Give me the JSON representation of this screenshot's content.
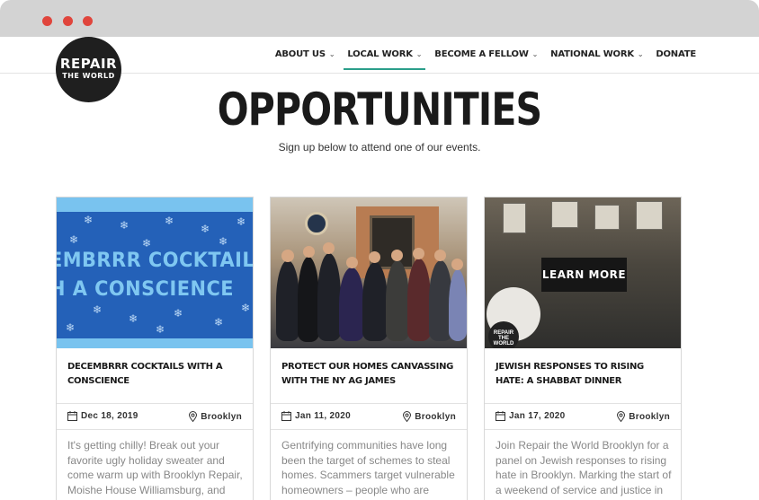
{
  "logo": {
    "line1": "REPAIR",
    "line2": "THE WORLD"
  },
  "nav": {
    "items": [
      {
        "label": "ABOUT US",
        "has_dropdown": true
      },
      {
        "label": "LOCAL WORK",
        "has_dropdown": true,
        "active": true
      },
      {
        "label": "BECOME A FELLOW",
        "has_dropdown": true
      },
      {
        "label": "NATIONAL WORK",
        "has_dropdown": true
      },
      {
        "label": "DONATE",
        "has_dropdown": false
      }
    ],
    "accent_color": "#2b9e8a"
  },
  "page": {
    "title": "OPPORTUNITIES",
    "subtitle": "Sign up below to attend one of our events."
  },
  "cards": [
    {
      "image": "snowflake-banner",
      "image_text_line1": "EMBRRR COCKTAILS",
      "image_text_line2": "H A CONSCIENCE",
      "title": "DECEMBRRR COCKTAILS WITH A CONSCIENCE",
      "date": "Dec 18, 2019",
      "location": "Brooklyn",
      "description": "It's getting chilly! Break out your favorite ugly holiday sweater and come warm up with Brooklyn Repair, Moishe House Williamsburg, and"
    },
    {
      "image": "group-photo",
      "title": "PROTECT OUR HOMES CANVASSING WITH THE NY AG JAMES",
      "date": "Jan 11, 2020",
      "location": "Brooklyn",
      "description": "Gentrifying communities have long been the target of schemes to steal homes. Scammers target vulnerable homeowners – people who are"
    },
    {
      "image": "dinner-event-photo",
      "overlay_button": "LEARN MORE",
      "sticker_line1": "REPAIR",
      "sticker_line2": "THE WORLD",
      "title": "JEWISH RESPONSES TO RISING HATE: A SHABBAT DINNER",
      "date": "Jan 17, 2020",
      "location": "Brooklyn",
      "description": "Join Repair the World Brooklyn for a panel on Jewish responses to rising hate in Brooklyn. Marking the start of a weekend of service and justice in"
    }
  ]
}
